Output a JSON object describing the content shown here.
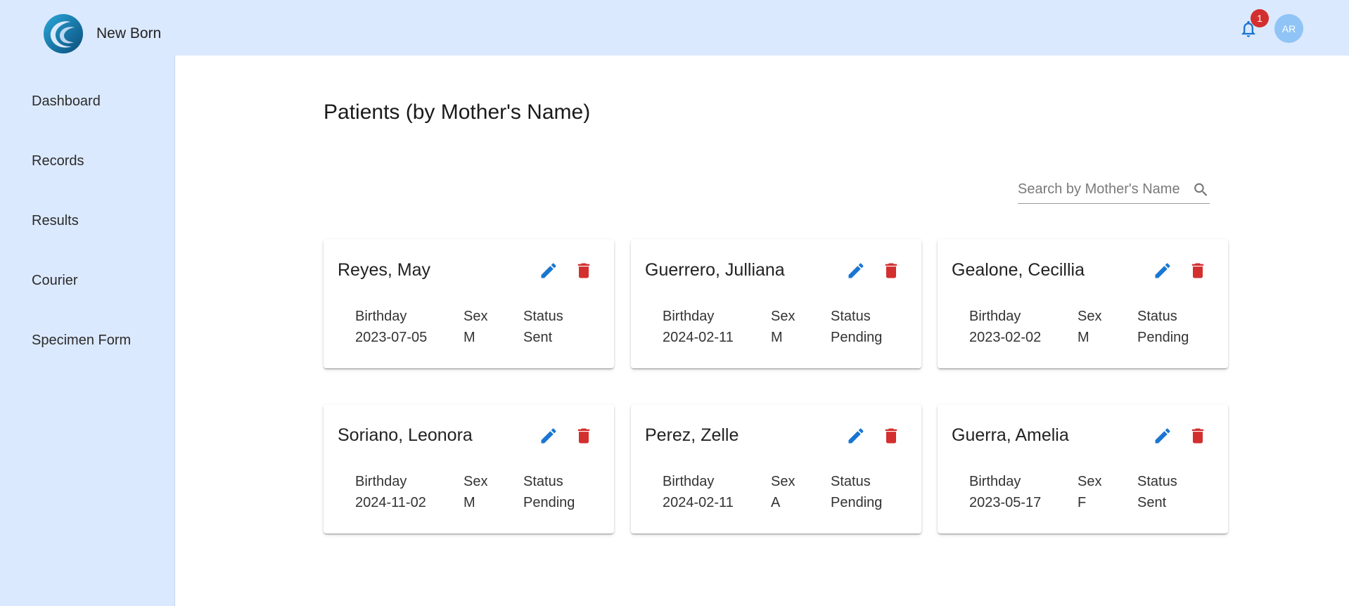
{
  "app": {
    "name": "New Born"
  },
  "header": {
    "notification_count": "1",
    "avatar_initials": "AR"
  },
  "sidebar": {
    "items": [
      {
        "label": "Dashboard"
      },
      {
        "label": "Records"
      },
      {
        "label": "Results"
      },
      {
        "label": "Courier"
      },
      {
        "label": "Specimen Form"
      }
    ]
  },
  "page": {
    "title": "Patients (by Mother's Name)"
  },
  "search": {
    "placeholder": "Search by Mother's Name",
    "value": ""
  },
  "labels": {
    "birthday": "Birthday",
    "sex": "Sex",
    "status": "Status"
  },
  "patients": [
    {
      "name": "Reyes, May",
      "birthday": "2023-07-05",
      "sex": "M",
      "status": "Sent"
    },
    {
      "name": "Guerrero, Julliana",
      "birthday": "2024-02-11",
      "sex": "M",
      "status": "Pending"
    },
    {
      "name": "Gealone, Cecillia",
      "birthday": "2023-02-02",
      "sex": "M",
      "status": "Pending"
    },
    {
      "name": "Soriano, Leonora",
      "birthday": "2024-11-02",
      "sex": "M",
      "status": "Pending"
    },
    {
      "name": "Perez, Zelle",
      "birthday": "2024-02-11",
      "sex": "A",
      "status": "Pending"
    },
    {
      "name": "Guerra, Amelia",
      "birthday": "2023-05-17",
      "sex": "F",
      "status": "Sent"
    }
  ],
  "colors": {
    "header_bg": "#dbe9fe",
    "edit_icon": "#1976d2",
    "delete_icon": "#d32f2f",
    "badge": "#d32f2f",
    "avatar": "#90c4f6"
  },
  "icons": {
    "edit": "pencil-icon",
    "delete": "trash-icon",
    "notifications": "bell-icon",
    "search": "search-icon"
  }
}
